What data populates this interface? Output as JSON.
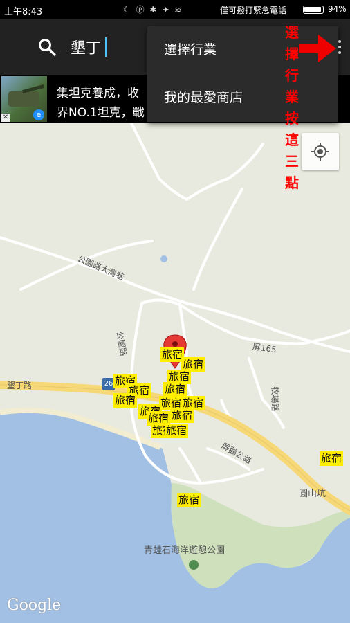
{
  "status_bar": {
    "time": "上午8:43",
    "icons": "☾ ⓟ ✱ ✈ ≋",
    "carrier": "僅可撥打緊急電話",
    "battery_level": 0.94,
    "battery_text": "94%"
  },
  "app_bar": {
    "search_text": "墾丁",
    "search_icon": "search-icon",
    "overflow_icon": "more-vert-icon"
  },
  "ad": {
    "line1": "集坦克養成，收",
    "line2": "界NO.1坦克，戰",
    "close": "✕",
    "badge": "e"
  },
  "overflow_menu": {
    "items": [
      "選擇行業",
      "我的最愛商店"
    ]
  },
  "annotation": {
    "text": [
      "選",
      "擇",
      "行",
      "業",
      "按",
      "這",
      "三",
      "點"
    ],
    "color": "#ff0000"
  },
  "map": {
    "road_labels": [
      "公園路大灣巷",
      "公園路",
      "墾丁路",
      "屏165",
      "屏鵝公路",
      "牧場路"
    ],
    "place_labels": [
      "圓山坑",
      "青蛙石海洋遊憩公園"
    ],
    "pois": [
      "旅宿",
      "旅宿",
      "旅宿",
      "旅宿",
      "旅宿",
      "旅宿",
      "旅宿",
      "旅宿",
      "旅宿",
      "旅宿",
      "旅宿",
      "旅宿",
      "旅宿",
      "旅宿",
      "旅宿",
      "旅宿"
    ],
    "highway_badge": "26",
    "attribution": "Google",
    "colors": {
      "land": "#e9eadf",
      "sea": "#a2c0e4",
      "highway": "#f6d877",
      "road": "#ffffff",
      "poi": "#ffee00",
      "pin": "#e53935"
    }
  }
}
